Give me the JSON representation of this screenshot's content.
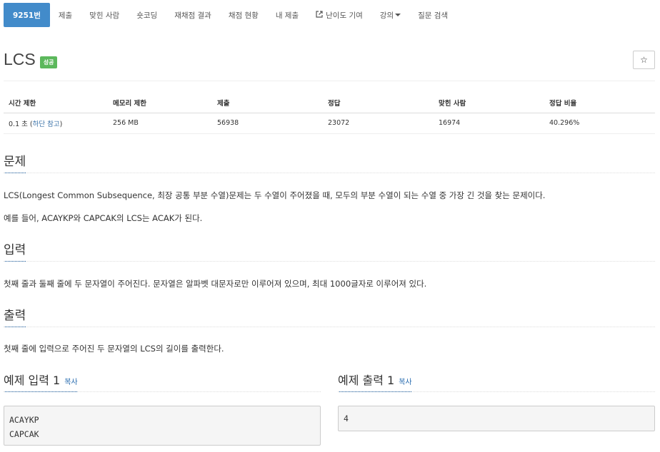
{
  "tabs": [
    {
      "label": "9251번",
      "active": true
    },
    {
      "label": "제출"
    },
    {
      "label": "맞힌 사람"
    },
    {
      "label": "숏코딩"
    },
    {
      "label": "재채점 결과"
    },
    {
      "label": "채점 현황"
    },
    {
      "label": "내 제출"
    },
    {
      "label": "난이도 기여",
      "icon": "external-link-icon"
    },
    {
      "label": "강의",
      "icon": "caret-down-icon"
    },
    {
      "label": "질문 검색"
    }
  ],
  "problem": {
    "title": "LCS",
    "badge": "성공",
    "star_icon": "☆"
  },
  "info": {
    "headers": [
      "시간 제한",
      "메모리 제한",
      "제출",
      "정답",
      "맞힌 사람",
      "정답 비율"
    ],
    "time_limit": "0.1 초 (",
    "time_limit_link": "하단 참고",
    "time_limit_close": ")",
    "memory_limit": "256 MB",
    "submissions": "56938",
    "accepted": "23072",
    "solvers": "16974",
    "ratio": "40.296%"
  },
  "sections": {
    "problem_heading": "문제",
    "problem_p1": "LCS(Longest Common Subsequence, 최장 공통 부분 수열)문제는 두 수열이 주어졌을 때, 모두의 부분 수열이 되는 수열 중 가장 긴 것을 찾는 문제이다.",
    "problem_p2": "예를 들어, ACAYKP와 CAPCAK의 LCS는 ACAK가 된다.",
    "input_heading": "입력",
    "input_text": "첫째 줄과 둘째 줄에 두 문자열이 주어진다. 문자열은 알파벳 대문자로만 이루어져 있으며, 최대 1000글자로 이루어져 있다.",
    "output_heading": "출력",
    "output_text": "첫째 줄에 입력으로 주어진 두 문자열의 LCS의 길이를 출력한다."
  },
  "samples": {
    "input_heading": "예제 입력 1",
    "output_heading": "예제 출력 1",
    "copy_label": "복사",
    "input_value": "ACAYKP\nCAPCAK",
    "output_value": "4"
  },
  "colors": {
    "active_tab": "#428bca",
    "badge": "#5cb85c",
    "link": "#2a6db0"
  }
}
